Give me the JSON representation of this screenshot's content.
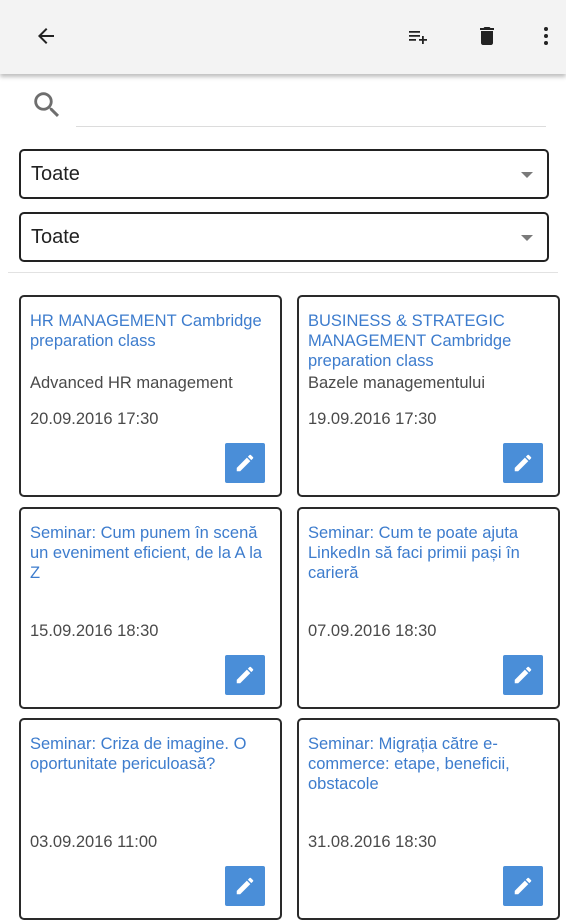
{
  "colors": {
    "toolbar_bg": "#f3f3f3",
    "accent_blue": "#3d7ccd",
    "edit_button": "#4a8ed8",
    "border": "#2a2a2a",
    "secondary_text": "#4a4a4a"
  },
  "toolbar": {
    "back_icon": "arrow-left-icon",
    "add_to_list_icon": "playlist-add-icon",
    "delete_icon": "trash-icon",
    "more_icon": "more-vertical-icon"
  },
  "search": {
    "icon": "search-icon",
    "value": "",
    "placeholder": ""
  },
  "filters": [
    {
      "selected": "Toate"
    },
    {
      "selected": "Toate"
    }
  ],
  "cards": [
    {
      "title": "HR MANAGEMENT Cambridge preparation class",
      "subtitle": "Advanced HR management",
      "date": "20.09.2016 17:30"
    },
    {
      "title": "BUSINESS & STRATEGIC MANAGEMENT Cambridge preparation class",
      "subtitle": "Bazele managementului",
      "date": "19.09.2016 17:30"
    },
    {
      "title": "Seminar: Cum punem în scenă un eveniment eficient, de la A la Z",
      "subtitle": "",
      "date": "15.09.2016 18:30"
    },
    {
      "title": "Seminar: Cum te poate ajuta LinkedIn să faci primii pași în carieră",
      "subtitle": "",
      "date": "07.09.2016 18:30"
    },
    {
      "title": "Seminar: Criza de imagine. O oportunitate periculoasă?",
      "subtitle": "",
      "date": "03.09.2016 11:00"
    },
    {
      "title": "Seminar: Migrația către e-commerce: etape, beneficii, obstacole",
      "subtitle": "",
      "date": "31.08.2016 18:30"
    }
  ]
}
